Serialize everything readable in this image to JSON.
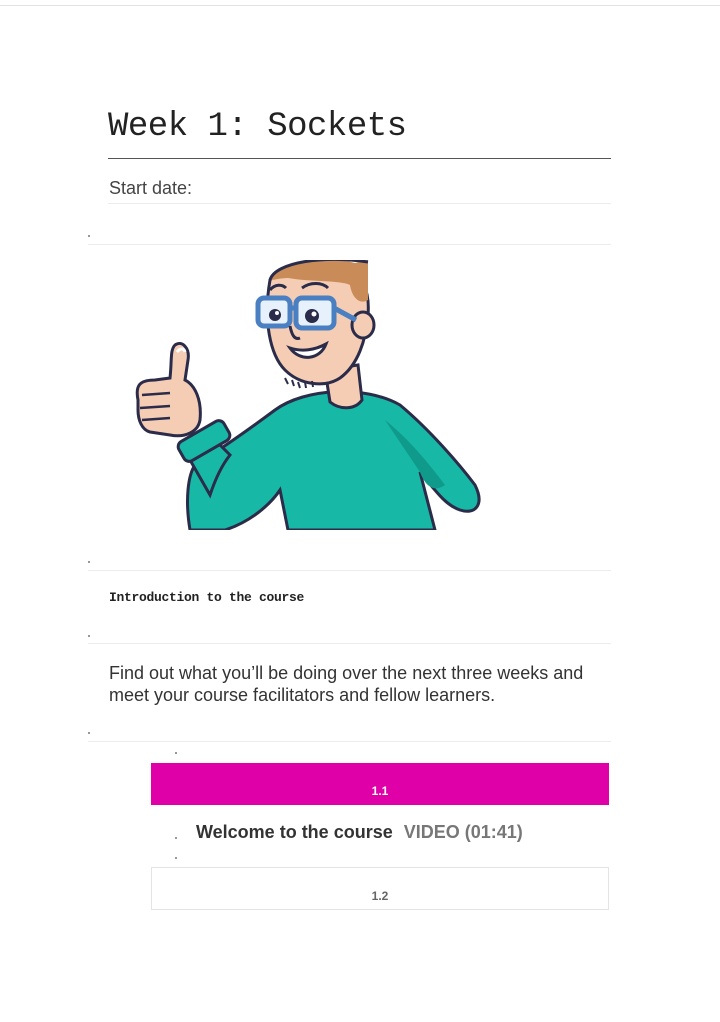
{
  "week": {
    "title": "Week 1: Sockets",
    "start_date_label": "Start date:"
  },
  "illustration": {
    "icon": "thumbs-up-man-illustration",
    "colors": {
      "sweater": "#17b8a6",
      "glasses": "#4a7fc1",
      "skin": "#f5cdb4",
      "hair": "#c98b58",
      "outline": "#2b2b4a"
    }
  },
  "intro": {
    "heading": "Introduction to the course",
    "description": "Find out what you’ll be doing over the next three weeks and meet your course facilitators and fellow learners."
  },
  "steps": [
    {
      "number": "1.1",
      "title": "Welcome to the course",
      "type": "VIDEO (01:41)",
      "active": true,
      "accent": "#df00a7"
    },
    {
      "number": "1.2",
      "active": false
    }
  ]
}
